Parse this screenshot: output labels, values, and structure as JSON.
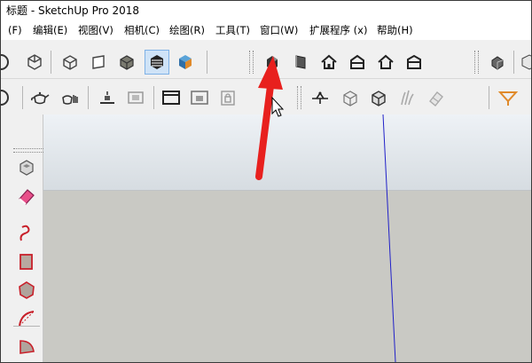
{
  "window": {
    "title": "标题 - SketchUp Pro 2018"
  },
  "menus": [
    {
      "label": "(F)"
    },
    {
      "label": "编辑(E)"
    },
    {
      "label": "视图(V)"
    },
    {
      "label": "相机(C)"
    },
    {
      "label": "绘图(R)"
    },
    {
      "label": "工具(T)"
    },
    {
      "label": "窗口(W)"
    },
    {
      "label": "扩展程序 (x)"
    },
    {
      "label": "帮助(H)"
    }
  ],
  "toolbar_row1_icons": [
    "circle-partial-icon",
    "cube-wireframe-icon",
    "xray-style-icon",
    "wireframe-style-icon",
    "hidden-line-style-icon",
    "shaded-style-icon",
    "shaded-with-textures-icon",
    "monochrome-style-icon",
    "iso-view-icon",
    "front-view-icon",
    "top-view-icon",
    "back-view-icon",
    "left-view-icon",
    "right-view-icon",
    "extra-cube-icon"
  ],
  "toolbar_row2_icons": [
    "circle-partial-icon",
    "teapot-icon",
    "orbit-teapot-icon",
    "section-plane-display-icon",
    "section-fill-icon",
    "window-frame-icon",
    "window-frame-shaded-icon",
    "lock-icon",
    "add-section-plane-icon",
    "display-section-cut-icon",
    "display-section-fill-icon",
    "smoothing-icon",
    "eraser-soft-icon",
    "orange-tool-icon"
  ],
  "left_toolbar_icons": [
    "paint-bucket-icon",
    "eraser-icon",
    "freehand-icon",
    "rectangle-icon",
    "polygon-icon",
    "arc-icon",
    "pie-icon"
  ],
  "colors": {
    "arrow": "#e8201e",
    "active_bg": "#cfe3f7",
    "blue_axis": "#2020c8",
    "sky_top": "#eef2f6",
    "ground": "#c9c9c4"
  }
}
